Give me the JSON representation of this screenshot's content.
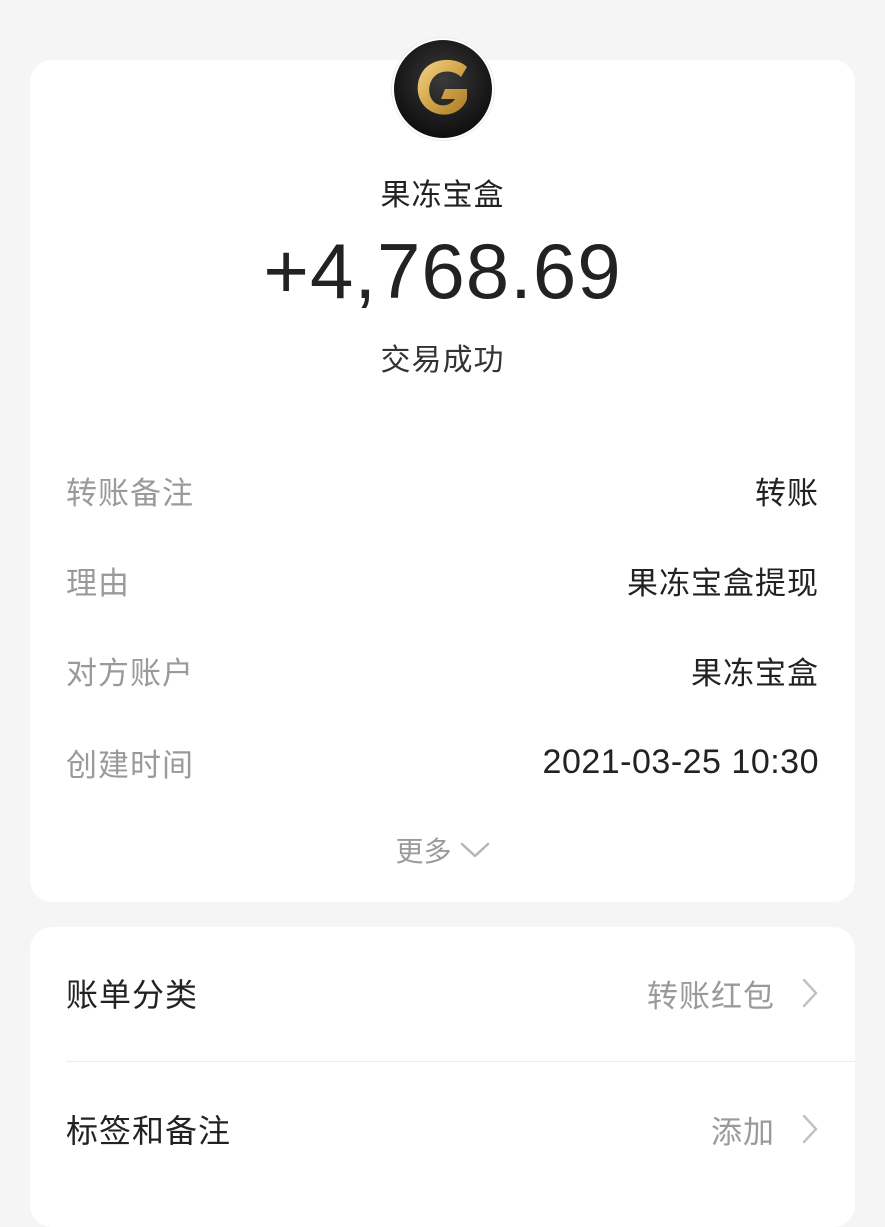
{
  "merchant": {
    "name": "果冻宝盒",
    "logo_icon": "gold-g-logo-icon"
  },
  "transaction": {
    "amount": "+4,768.69",
    "status": "交易成功"
  },
  "details": [
    {
      "label": "转账备注",
      "value": "转账"
    },
    {
      "label": "理由",
      "value": "果冻宝盒提现"
    },
    {
      "label": "对方账户",
      "value": "果冻宝盒"
    },
    {
      "label": "创建时间",
      "value": "2021-03-25 10:30"
    }
  ],
  "more": {
    "label": "更多",
    "icon": "chevron-down-icon"
  },
  "menu": [
    {
      "label": "账单分类",
      "value": "转账红包",
      "icon": "chevron-right-icon"
    },
    {
      "label": "标签和备注",
      "value": "添加",
      "icon": "chevron-right-icon"
    }
  ],
  "colors": {
    "background": "#f5f5f5",
    "card": "#ffffff",
    "text_primary": "#222222",
    "text_secondary": "#9a9a9a",
    "logo_dark": "#1a1a1a",
    "logo_gold": "#d4a64a"
  }
}
